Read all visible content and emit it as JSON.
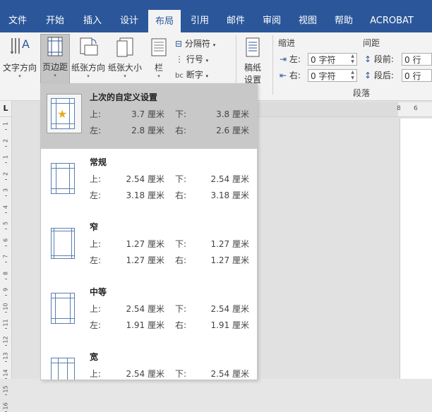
{
  "tabs": [
    "文件",
    "开始",
    "插入",
    "设计",
    "布局",
    "引用",
    "邮件",
    "审阅",
    "视图",
    "帮助",
    "ACROBAT"
  ],
  "active_tab": "布局",
  "ribbon": {
    "text_direction": "文字方向",
    "margins": "页边距",
    "orientation": "纸张方向",
    "size": "纸张大小",
    "columns": "栏",
    "breaks": "分隔符",
    "line_numbers": "行号",
    "hyphenation": "断字",
    "draft_paper_line1": "稿纸",
    "draft_paper_line2": "设置",
    "indent_title": "缩进",
    "spacing_title": "间距",
    "indent_left_label": "左:",
    "indent_right_label": "右:",
    "indent_left_value": "0 字符",
    "indent_right_value": "0 字符",
    "spacing_before_label": "段前:",
    "spacing_after_label": "段后:",
    "spacing_before_value": "0 行",
    "spacing_after_value": "0 行",
    "paragraph_group": "段落"
  },
  "ruler": {
    "corner": "L",
    "h_ticks": [
      "8",
      "6"
    ],
    "v_numbers": [
      "1",
      "2",
      "1",
      "2",
      "3",
      "4",
      "5",
      "6",
      "7",
      "8",
      "9",
      "10",
      "11",
      "12",
      "13",
      "14",
      "15",
      "16"
    ]
  },
  "margin_options": [
    {
      "name": "上次的自定义设置",
      "top_label": "上:",
      "top": "3.7 厘米",
      "bottom_label": "下:",
      "bottom": "3.8 厘米",
      "left_label": "左:",
      "left": "2.8 厘米",
      "right_label": "右:",
      "right": "2.6 厘米",
      "selected": true
    },
    {
      "name": "常规",
      "top_label": "上:",
      "top": "2.54 厘米",
      "bottom_label": "下:",
      "bottom": "2.54 厘米",
      "left_label": "左:",
      "left": "3.18 厘米",
      "right_label": "右:",
      "right": "3.18 厘米",
      "selected": false
    },
    {
      "name": "窄",
      "top_label": "上:",
      "top": "1.27 厘米",
      "bottom_label": "下:",
      "bottom": "1.27 厘米",
      "left_label": "左:",
      "left": "1.27 厘米",
      "right_label": "右:",
      "right": "1.27 厘米",
      "selected": false
    },
    {
      "name": "中等",
      "top_label": "上:",
      "top": "2.54 厘米",
      "bottom_label": "下:",
      "bottom": "2.54 厘米",
      "left_label": "左:",
      "left": "1.91 厘米",
      "right_label": "右:",
      "right": "1.91 厘米",
      "selected": false
    },
    {
      "name": "宽",
      "top_label": "上:",
      "top": "2.54 厘米",
      "bottom_label": "下:",
      "bottom": "2.54 厘米",
      "left_label": "",
      "left": "",
      "right_label": "",
      "right": "",
      "selected": false
    }
  ],
  "colors": {
    "accent": "#2b579a",
    "selected_bg": "#c8c8c8",
    "star": "#e8a928"
  }
}
